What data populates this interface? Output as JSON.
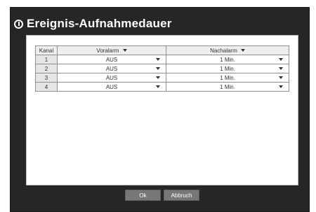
{
  "window": {
    "title": "Ereignis-Aufnahmedauer",
    "title_icon": "power-icon"
  },
  "table": {
    "headers": {
      "kanal": "Kanal",
      "voralarm": "Voralarm",
      "nachalarm": "Nachalarm"
    },
    "rows": [
      {
        "kanal": "1",
        "voralarm": "AUS",
        "nachalarm": "1 Min."
      },
      {
        "kanal": "2",
        "voralarm": "AUS",
        "nachalarm": "1 Min."
      },
      {
        "kanal": "3",
        "voralarm": "AUS",
        "nachalarm": "1 Min."
      },
      {
        "kanal": "4",
        "voralarm": "AUS",
        "nachalarm": "1 Min."
      }
    ]
  },
  "buttons": {
    "ok": "Ok",
    "cancel": "Abbruch"
  }
}
